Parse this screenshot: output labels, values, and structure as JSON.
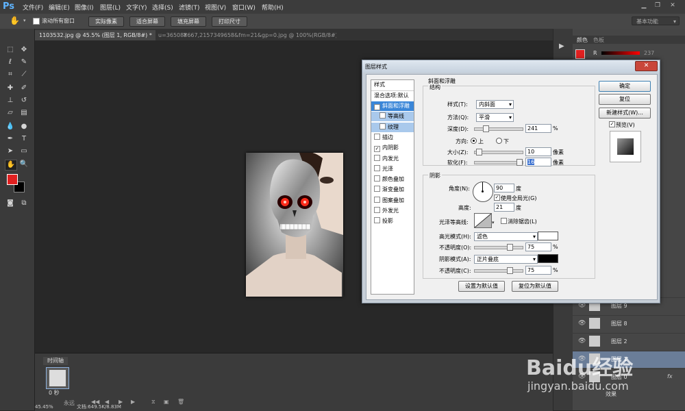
{
  "app": {
    "logo": "Ps"
  },
  "menu": [
    "文件(F)",
    "编辑(E)",
    "图像(I)",
    "图层(L)",
    "文字(Y)",
    "选择(S)",
    "滤镜(T)",
    "视图(V)",
    "窗口(W)",
    "帮助(H)"
  ],
  "options": {
    "scroll_all_label": "滚动所有窗口",
    "btn_actual": "实际像素",
    "btn_fit": "适合屏幕",
    "btn_fill": "填充屏幕",
    "btn_print": "打印尺寸",
    "workspace": "基本功能"
  },
  "tabs": [
    {
      "label": "1103532.jpg @ 45.5% (图层 1, RGB/8#) *"
    },
    {
      "label": "u=365082667,2157349658&fm=21&gp=0.jpg @ 100%(RGB/8#)"
    }
  ],
  "dialog": {
    "title": "图层样式",
    "styles_header": "样式",
    "blend_options": "混合选项:默认",
    "items": [
      {
        "label": "斜面和浮雕",
        "checked": true,
        "active": true,
        "sub": false
      },
      {
        "label": "等高线",
        "checked": false,
        "active": false,
        "sub": true
      },
      {
        "label": "纹理",
        "checked": false,
        "active": false,
        "sub": true
      },
      {
        "label": "描边",
        "checked": false,
        "active": false,
        "sub": false
      },
      {
        "label": "内阴影",
        "checked": true,
        "active": false,
        "sub": false
      },
      {
        "label": "内发光",
        "checked": false,
        "active": false,
        "sub": false
      },
      {
        "label": "光泽",
        "checked": false,
        "active": false,
        "sub": false
      },
      {
        "label": "颜色叠加",
        "checked": false,
        "active": false,
        "sub": false
      },
      {
        "label": "渐变叠加",
        "checked": false,
        "active": false,
        "sub": false
      },
      {
        "label": "图案叠加",
        "checked": false,
        "active": false,
        "sub": false
      },
      {
        "label": "外发光",
        "checked": false,
        "active": false,
        "sub": false
      },
      {
        "label": "投影",
        "checked": false,
        "active": false,
        "sub": false
      }
    ],
    "section_title": "斜面和浮雕",
    "structure": {
      "title": "结构",
      "style_label": "样式(T):",
      "style_value": "内斜面",
      "method_label": "方法(Q):",
      "method_value": "平滑",
      "depth_label": "深度(D):",
      "depth_value": "241",
      "depth_unit": "%",
      "depth_level": 0.2,
      "direction_label": "方向:",
      "dir_up": "上",
      "dir_down": "下",
      "size_label": "大小(Z):",
      "size_value": "10",
      "size_unit": "像素",
      "size_level": 0.04,
      "soften_label": "软化(F):",
      "soften_value": "16",
      "soften_unit": "像素",
      "soften_level": 0.98
    },
    "shading": {
      "title": "阴影",
      "angle_label": "角度(N):",
      "angle_value": "90",
      "angle_unit": "度",
      "global_light": "使用全局光(G)",
      "altitude_label": "高度:",
      "altitude_value": "21",
      "altitude_unit": "度",
      "gloss_label": "光泽等高线:",
      "antialias": "消除锯齿(L)",
      "highlight_label": "高光模式(H):",
      "highlight_value": "滤色",
      "highlight_color": "#ffffff",
      "opacity1_label": "不透明度(O):",
      "opacity1_value": "75",
      "opacity1_unit": "%",
      "opacity1_level": 0.75,
      "shadow_label": "阴影模式(A):",
      "shadow_value": "正片叠底",
      "shadow_color": "#000000",
      "opacity2_label": "不透明度(C):",
      "opacity2_value": "75",
      "opacity2_unit": "%",
      "opacity2_level": 0.75
    },
    "btn_set_default": "设置为默认值",
    "btn_reset_default": "复位为默认值",
    "btn_ok": "确定",
    "btn_reset": "复位",
    "btn_new_style": "新建样式(W)...",
    "preview_label": "预览(V)"
  },
  "right": {
    "color_tab": "颜色",
    "swatch_tab": "色板",
    "r_label": "R",
    "r_value": "237",
    "foreground": "#e02020",
    "layers": [
      {
        "name": "图层 9"
      },
      {
        "name": "图层 8"
      },
      {
        "name": "图层 2"
      },
      {
        "name": "图层 1",
        "selected": true
      },
      {
        "name": "图层 0"
      }
    ],
    "effects_label": "效果"
  },
  "timeline": {
    "tab": "时间轴",
    "frame_time": "0 秒",
    "loop": "永远"
  },
  "status": {
    "zoom": "45.45%",
    "doc": "文档:649.5K/8.83M"
  },
  "watermark": {
    "brand": "Baidu经验",
    "url": "jingyan.baidu.com"
  }
}
